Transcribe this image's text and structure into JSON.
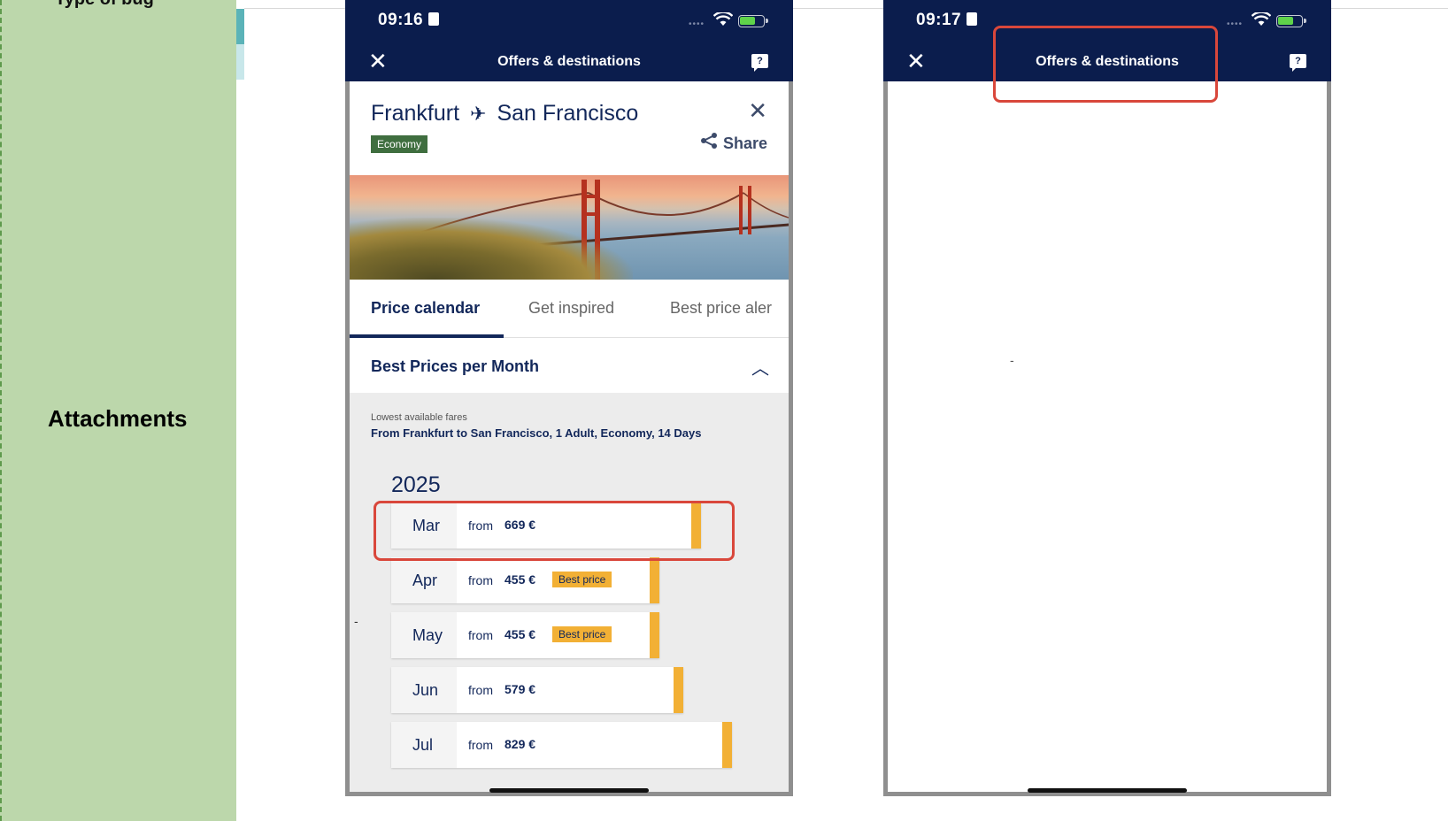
{
  "left_panel": {
    "cut_label": "Type of bug",
    "attachments_label": "Attachments"
  },
  "screen1": {
    "status": {
      "time": "09:16"
    },
    "appbar": {
      "title": "Offers & destinations",
      "feedback_icon": "?"
    },
    "route": {
      "origin": "Frankfurt",
      "destination": "San Francisco",
      "cabin_badge": "Economy",
      "share_label": "Share"
    },
    "tabs": [
      "Price calendar",
      "Get inspired",
      "Best price aler"
    ],
    "section": {
      "title": "Best Prices per Month"
    },
    "fares": {
      "subtitle": "Lowest available fares",
      "description": "From Frankfurt to San Francisco, 1 Adult, Economy, 14 Days",
      "year": "2025",
      "from_label": "from",
      "months": [
        {
          "month": "Mar",
          "price": "669 €",
          "badge": ""
        },
        {
          "month": "Apr",
          "price": "455 €",
          "badge": "Best price"
        },
        {
          "month": "May",
          "price": "455 €",
          "badge": "Best price"
        },
        {
          "month": "Jun",
          "price": "579 €",
          "badge": ""
        },
        {
          "month": "Jul",
          "price": "829 €",
          "badge": ""
        }
      ],
      "dash": "-"
    }
  },
  "screen2": {
    "status": {
      "time": "09:17"
    },
    "appbar": {
      "title": "Offers & destinations",
      "feedback_icon": "?"
    },
    "dash": "-"
  },
  "colors": {
    "navy": "#0b1d4d",
    "accent_yellow": "#f2b035",
    "highlight_red": "#d9473b",
    "economy_green": "#3f6e3f",
    "panel_green": "#bcd7ab"
  }
}
